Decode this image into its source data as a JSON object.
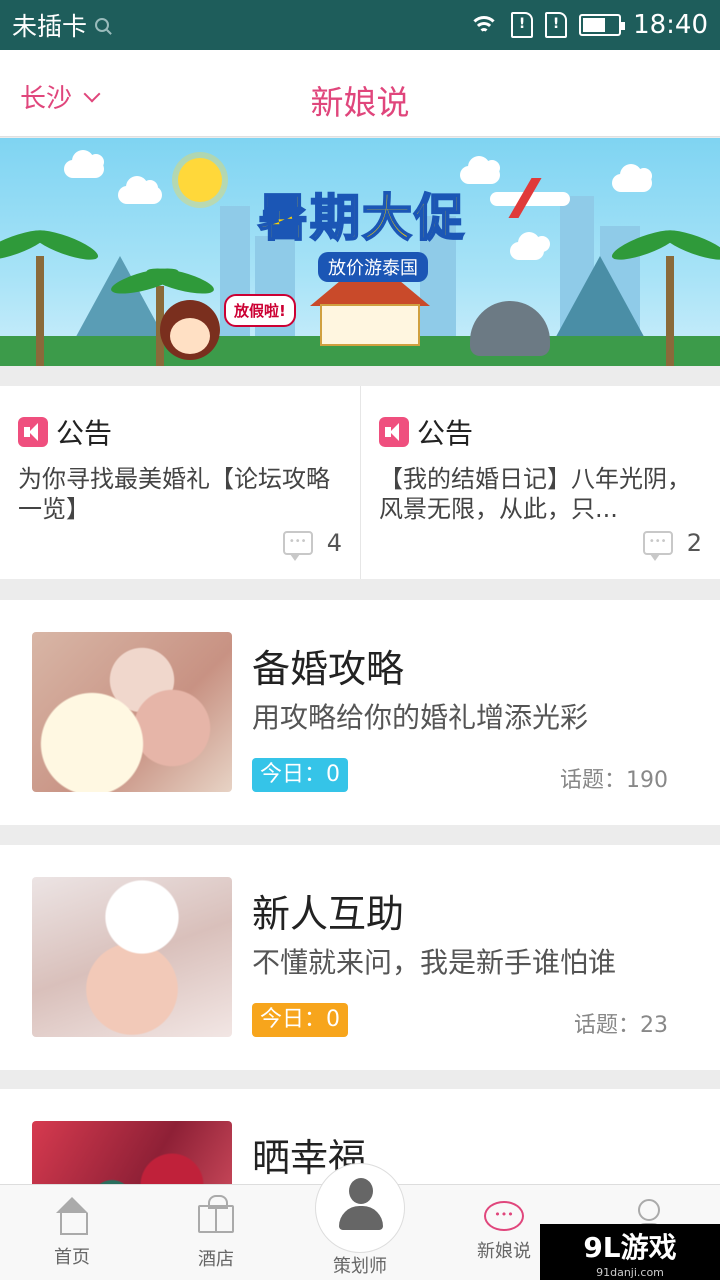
{
  "status_bar": {
    "carrier": "未插卡",
    "time": "18:40"
  },
  "header": {
    "city": "长沙",
    "title": "新娘说"
  },
  "banner": {
    "headline": "暑期大促",
    "subline": "放价游泰国",
    "speech": "放假啦!"
  },
  "notices": [
    {
      "label": "公告",
      "text": "为你寻找最美婚礼【论坛攻略一览】",
      "comments": "4"
    },
    {
      "label": "公告",
      "text": "【我的结婚日记】八年光阴，风景无限，从此，只...",
      "comments": "2"
    }
  ],
  "forums": [
    {
      "title": "备婚攻略",
      "desc": "用攻略给你的婚礼增添光彩",
      "today": "今日：0",
      "topics": "话题：190",
      "badge_color": "#35c4e8"
    },
    {
      "title": "新人互助",
      "desc": "不懂就来问，我是新手谁怕谁",
      "today": "今日：0",
      "topics": "话题：23",
      "badge_color": "#f7a51c"
    },
    {
      "title": "晒幸福",
      "desc": "",
      "today": "",
      "topics": ""
    }
  ],
  "nav": {
    "home": "首页",
    "hotel": "酒店",
    "planner": "策划师",
    "bride": "新娘说",
    "mine": ""
  },
  "watermark": {
    "main": "9L游戏",
    "sub": "91danji.com"
  },
  "colors": {
    "accent": "#e0467c",
    "status_bar": "#1e5d5b"
  }
}
